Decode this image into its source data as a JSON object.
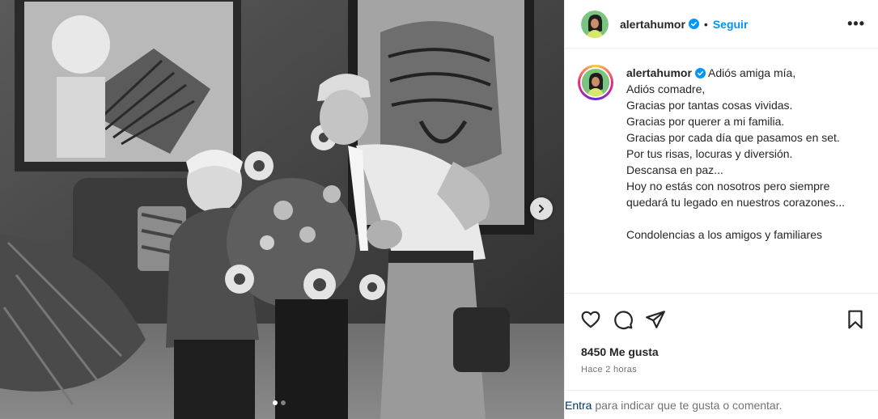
{
  "post": {
    "username": "alertahumor",
    "separator": "•",
    "follow_label": "Seguir",
    "more_label": "•••",
    "caption_user": "alertahumor",
    "caption_text": "Adiós amiga mía,\nAdiós comadre,\nGracias por tantas cosas vividas.\nGracias por querer a mi familia.\nGracias por cada día que pasamos en set.\nPor tus risas, locuras y diversión.\nDescansa en paz...\nHoy no estás con nosotros pero siempre quedará tu legado en nuestros corazones...\n\nCondolencias a los amigos y familiares",
    "likes": "8450 Me gusta",
    "time": "Hace 2 horas",
    "footer_link": "Entra",
    "footer_text": " para indicar que te gusta o comentar."
  },
  "icons": {
    "verified": "verified-badge-icon",
    "like": "heart-icon",
    "comment": "comment-icon",
    "share": "paper-plane-icon",
    "save": "bookmark-icon",
    "next": "chevron-right-icon"
  },
  "carousel": {
    "total": 2,
    "current": 1
  },
  "colors": {
    "accent": "#0095f6",
    "verified": "#0095f6",
    "link": "#00376b",
    "muted": "#737373"
  }
}
